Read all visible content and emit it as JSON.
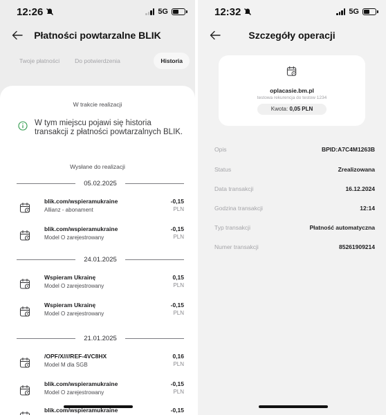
{
  "left": {
    "status": {
      "time": "12:26",
      "network": "5G"
    },
    "nav": {
      "title": "Płatności powtarzalne BLIK"
    },
    "tabs": [
      {
        "label": "Twoje płatności",
        "active": false
      },
      {
        "label": "Do potwierdzenia",
        "active": false
      },
      {
        "label": "Historia",
        "active": true
      }
    ],
    "in_progress": {
      "title": "W trakcie realizacji",
      "info": "W tym miejscu pojawi się historia transakcji z płatności powtarzalnych BLIK."
    },
    "sent": {
      "title": "Wysłane do realizacji",
      "dates": [
        "05.02.2025",
        "24.01.2025",
        "21.01.2025"
      ],
      "transactions": [
        {
          "name": "blik.com/wspieramukraine",
          "sub": "Allianz - abonament",
          "amount": "-0,15",
          "currency": "PLN"
        },
        {
          "name": "blik.com/wspieramukraine",
          "sub": "Model O zarejestrowany",
          "amount": "-0,15",
          "currency": "PLN"
        },
        {
          "name": "Wspieram Ukrainę",
          "sub": "Model O zarejestrowany",
          "amount": "0,15",
          "currency": "PLN"
        },
        {
          "name": "Wspieram Ukrainę",
          "sub": "Model O zarejestrowany",
          "amount": "-0,15",
          "currency": "PLN"
        },
        {
          "name": "/OPF/X////REF-4VC8HX",
          "sub": "Model M dla SGB",
          "amount": "0,16",
          "currency": "PLN"
        },
        {
          "name": "blik.com/wspieramukraine",
          "sub": "Model O zarejestrowany",
          "amount": "-0,15",
          "currency": "PLN"
        },
        {
          "name": "blik.com/wspieramukraine",
          "sub": "",
          "amount": "-0,15",
          "currency": ""
        }
      ]
    }
  },
  "right": {
    "status": {
      "time": "12:32",
      "network": "5G"
    },
    "nav": {
      "title": "Szczegóły operacji"
    },
    "card": {
      "merchant": "oplacasie.bm.pl",
      "description": "testowa rekurencja do testow 1234",
      "amount_label": "Kwota:",
      "amount_value": "0,05 PLN"
    },
    "details": [
      {
        "label": "Opis",
        "value": "BPID:A7C4M1263B"
      },
      {
        "label": "Status",
        "value": "Zrealizowana"
      },
      {
        "label": "Data transakcji",
        "value": "16.12.2024"
      },
      {
        "label": "Godzina transakcji",
        "value": "12:14"
      },
      {
        "label": "Typ transakcji",
        "value": "Płatność automatyczna"
      },
      {
        "label": "Numer transakcji",
        "value": "85261909214"
      }
    ]
  },
  "colors": {
    "background": "#ededed",
    "card": "#ffffff",
    "text": "#1c1c1e",
    "muted": "#a4a4a8"
  }
}
